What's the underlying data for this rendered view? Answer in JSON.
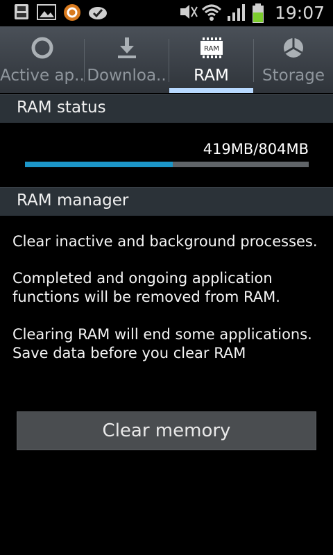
{
  "status_bar": {
    "time": "19:07",
    "icons": [
      "sd-card-icon",
      "gallery-icon",
      "app-icon",
      "sync-icon",
      "silent-mode-icon",
      "wifi-icon",
      "signal-icon",
      "battery-icon"
    ]
  },
  "tabs": [
    {
      "label": "Active ap..",
      "icon": "active-apps-icon",
      "active": false
    },
    {
      "label": "Downloa..",
      "icon": "download-icon",
      "active": false
    },
    {
      "label": "RAM",
      "icon": "ram-icon",
      "active": true
    },
    {
      "label": "Storage",
      "icon": "storage-icon",
      "active": false
    }
  ],
  "ram_status": {
    "title": "RAM status",
    "usage_text": "419MB/804MB",
    "used_fraction": 0.521
  },
  "ram_manager": {
    "title": "RAM manager",
    "paragraph1": "Clear inactive and background processes.",
    "paragraph2": "Completed and ongoing application functions will be removed from RAM.",
    "paragraph3": "Clearing RAM will end some applications. Save data before you clear RAM"
  },
  "actions": {
    "clear_memory_label": "Clear memory"
  },
  "colors": {
    "accent_blue": "#1c96c8",
    "tab_indicator": "#b8d9ff",
    "header_bg": "#2b3238"
  }
}
